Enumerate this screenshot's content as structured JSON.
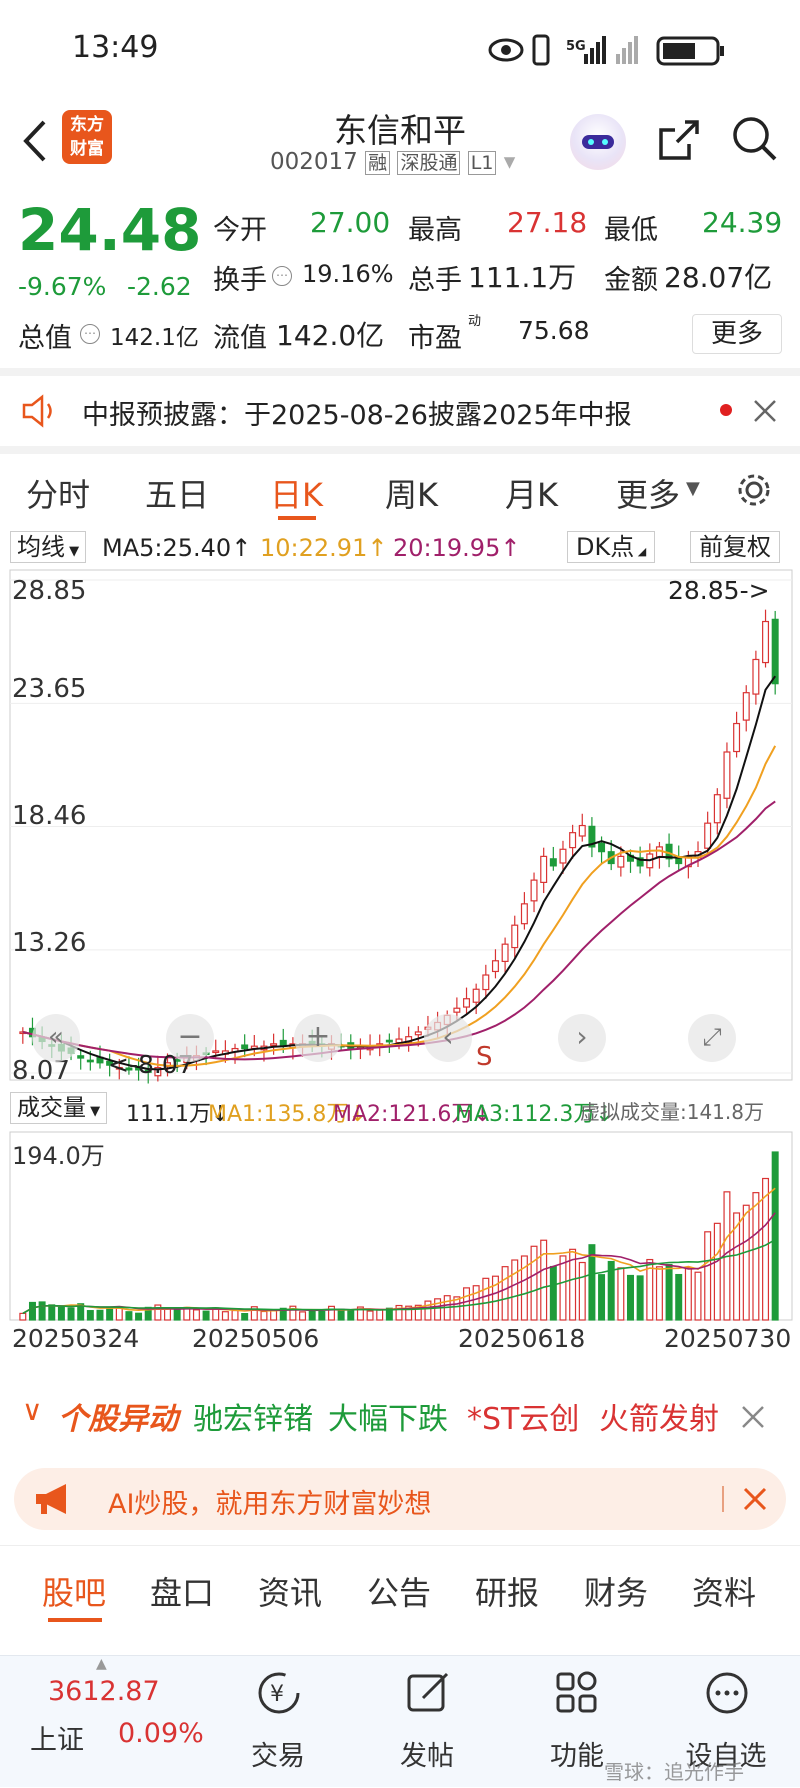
{
  "status": {
    "time": "13:49",
    "network": "5G"
  },
  "header": {
    "logo_line1": "东方",
    "logo_line2": "财富",
    "stock_name": "东信和平",
    "code": "002017",
    "tag_margin": "融",
    "tag_connect": "深股通",
    "tag_level": "L1"
  },
  "quote": {
    "price": "24.48",
    "change_pct": "-9.67%",
    "change": "-2.62",
    "open_label": "今开",
    "open": "27.00",
    "high_label": "最高",
    "high": "27.18",
    "low_label": "最低",
    "low": "24.39",
    "turnover_label": "换手",
    "turnover": "19.16%",
    "volume_label": "总手",
    "volume": "111.1万",
    "amount_label": "金额",
    "amount": "28.07亿",
    "mcap_label": "总值",
    "mcap": "142.1亿",
    "float_label": "流值",
    "float": "142.0亿",
    "pe_label": "市盈",
    "pe_sup": "动",
    "pe": "75.68",
    "more_button": "更多"
  },
  "notice": {
    "text": "中报预披露：于2025-08-26披露2025年中报"
  },
  "periods": {
    "items": [
      "分时",
      "五日",
      "日K",
      "周K",
      "月K",
      "更多"
    ],
    "active": "日K"
  },
  "chart_toolbar": {
    "indicator": "均线",
    "ma5": "MA5:25.40↑",
    "ma10": "10:22.91↑",
    "ma20": "20:19.95↑",
    "dk_button": "DK点",
    "adjust_button": "前复权"
  },
  "chart_labels": {
    "high_marker": "28.85->",
    "low_marker": "<-8.07",
    "signal": "S"
  },
  "volume_toolbar": {
    "indicator": "成交量",
    "vol": "111.1万↓",
    "ma1": "MA1:135.8万↓",
    "ma2": "MA2:121.6万↓",
    "ma3": "MA3:112.3万↓",
    "virtual": "虚拟成交量:141.8万"
  },
  "movers": {
    "title": "个股异动",
    "items": [
      {
        "name": "驰宏锌锗",
        "color": "#1e9b3a"
      },
      {
        "name": "大幅下跌",
        "color": "#1e9b3a"
      },
      {
        "name": "*ST云创",
        "color": "#d93333"
      },
      {
        "name": "火箭发射",
        "color": "#d93333"
      }
    ]
  },
  "ai_banner": {
    "text": "AI炒股，就用东方财富妙想"
  },
  "bottom_tabs": {
    "items": [
      "股吧",
      "盘口",
      "资讯",
      "公告",
      "研报",
      "财务",
      "资料"
    ],
    "active": "股吧"
  },
  "bottom_nav": {
    "index_value": "3612.87",
    "index_name": "上证",
    "index_change": "0.09%",
    "trade": "交易",
    "post": "发帖",
    "functions": "功能",
    "watch": "设自选",
    "watermark": "雪球：追光作手"
  },
  "colors": {
    "up": "#d93333",
    "down": "#1e9b3a",
    "accent": "#e8561c",
    "ma5": "#111111",
    "ma10": "#f0a020",
    "ma20": "#a0206a"
  },
  "chart_data": {
    "type": "candlestick",
    "y_ticks": [
      "28.85",
      "23.65",
      "18.46",
      "13.26",
      "8.07"
    ],
    "ylim": [
      8.07,
      28.85
    ],
    "x_ticks": [
      "20250324",
      "20250506",
      "20250618",
      "20250730"
    ],
    "volume_max_label": "194.0万",
    "close_series": [
      9.8,
      9.6,
      9.4,
      9.2,
      9.0,
      8.9,
      8.7,
      8.6,
      8.5,
      8.4,
      8.3,
      8.2,
      8.2,
      8.1,
      8.3,
      8.5,
      8.6,
      8.7,
      8.8,
      8.9,
      9.0,
      9.0,
      9.1,
      9.1,
      9.2,
      9.2,
      9.3,
      9.2,
      9.3,
      9.3,
      9.2,
      9.2,
      9.3,
      9.2,
      9.1,
      9.2,
      9.2,
      9.3,
      9.4,
      9.5,
      9.6,
      9.8,
      10.0,
      10.2,
      10.5,
      10.8,
      11.2,
      11.6,
      12.2,
      12.8,
      13.5,
      14.3,
      15.2,
      16.2,
      17.2,
      16.8,
      17.5,
      18.2,
      18.5,
      17.6,
      17.4,
      16.9,
      17.2,
      17.0,
      16.8,
      17.3,
      17.6,
      17.1,
      16.9,
      17.2,
      17.4,
      18.6,
      19.8,
      21.6,
      22.8,
      24.1,
      25.5,
      27.1,
      24.48
    ]
  }
}
